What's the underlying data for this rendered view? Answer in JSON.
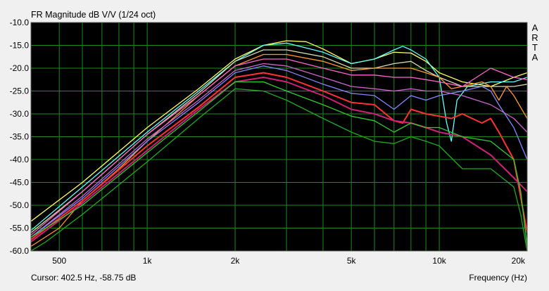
{
  "chart_data": {
    "type": "line",
    "title": "FR Magnitude dB V/V (1/24 oct)",
    "brand_letters": [
      "A",
      "R",
      "T",
      "A"
    ],
    "cursor_readout": "Cursor: 402.5 Hz, -58.75 dB",
    "xlabel": "Frequency (Hz)",
    "ylabel": "",
    "x_scale": "log",
    "xlim": [
      400,
      20000
    ],
    "ylim": [
      -60,
      -10
    ],
    "y_ticks": [
      -10,
      -15,
      -20,
      -25,
      -30,
      -35,
      -40,
      -45,
      -50,
      -55,
      -60
    ],
    "y_tick_labels": [
      "-10.0",
      "-15.0",
      "-20.0",
      "-25.0",
      "-30.0",
      "-35.0",
      "-40.0",
      "-45.0",
      "-50.0",
      "-55.0",
      "-60.0"
    ],
    "x_ticks": [
      500,
      1000,
      2000,
      5000,
      10000,
      20000
    ],
    "x_tick_labels": [
      "500",
      "1k",
      "2k",
      "5k",
      "10k",
      "20k"
    ],
    "x_minor_grid": [
      600,
      700,
      800,
      900,
      3000,
      4000,
      6000,
      7000,
      8000,
      9000
    ],
    "grid": true,
    "background": "#000000",
    "grid_color": "#1f8a1f",
    "series": [
      {
        "color": "#ffff66",
        "points": [
          [
            400,
            -53.5
          ],
          [
            600,
            -45
          ],
          [
            1000,
            -33
          ],
          [
            1500,
            -24.5
          ],
          [
            2000,
            -18
          ],
          [
            2500,
            -15
          ],
          [
            3000,
            -14
          ],
          [
            3500,
            -14.2
          ],
          [
            4000,
            -15.8
          ],
          [
            5000,
            -19
          ],
          [
            6000,
            -18
          ],
          [
            7000,
            -16.5
          ],
          [
            8000,
            -16.7
          ],
          [
            9000,
            -18.5
          ],
          [
            10000,
            -21
          ],
          [
            12000,
            -23
          ],
          [
            15000,
            -24
          ],
          [
            18000,
            -22
          ],
          [
            20000,
            -21
          ]
        ]
      },
      {
        "color": "#66ffff",
        "points": [
          [
            400,
            -55.5
          ],
          [
            600,
            -46
          ],
          [
            1000,
            -34
          ],
          [
            1500,
            -25
          ],
          [
            2000,
            -18.5
          ],
          [
            2500,
            -15
          ],
          [
            3000,
            -14.5
          ],
          [
            4000,
            -16.5
          ],
          [
            5000,
            -19
          ],
          [
            6000,
            -18
          ],
          [
            7000,
            -16
          ],
          [
            7500,
            -15.2
          ],
          [
            8000,
            -16
          ],
          [
            9000,
            -18
          ],
          [
            10000,
            -22
          ],
          [
            10600,
            -32
          ],
          [
            11000,
            -36
          ],
          [
            11500,
            -27
          ],
          [
            12500,
            -24
          ],
          [
            15000,
            -23
          ],
          [
            18000,
            -23
          ],
          [
            20000,
            -22
          ]
        ]
      },
      {
        "color": "#d9d9b0",
        "points": [
          [
            400,
            -56
          ],
          [
            600,
            -47
          ],
          [
            1000,
            -34.5
          ],
          [
            1500,
            -25.5
          ],
          [
            2000,
            -18.5
          ],
          [
            2500,
            -16
          ],
          [
            3000,
            -16
          ],
          [
            4000,
            -17.5
          ],
          [
            5000,
            -20
          ],
          [
            6000,
            -20
          ],
          [
            7000,
            -19
          ],
          [
            8000,
            -18.5
          ],
          [
            9000,
            -20.5
          ],
          [
            10000,
            -22
          ],
          [
            12000,
            -24
          ],
          [
            15000,
            -24
          ],
          [
            18000,
            -24
          ],
          [
            20000,
            -23.5
          ]
        ]
      },
      {
        "color": "#ff9933",
        "points": [
          [
            400,
            -59
          ],
          [
            500,
            -55
          ],
          [
            600,
            -49
          ],
          [
            800,
            -42
          ],
          [
            1000,
            -36
          ],
          [
            1500,
            -26
          ],
          [
            2000,
            -19.5
          ],
          [
            2500,
            -17
          ],
          [
            3000,
            -17
          ],
          [
            4000,
            -18.5
          ],
          [
            5000,
            -20.5
          ],
          [
            6000,
            -20
          ],
          [
            7000,
            -20
          ],
          [
            8000,
            -20
          ],
          [
            9000,
            -21
          ],
          [
            10000,
            -22
          ],
          [
            11000,
            -24.5
          ],
          [
            12000,
            -24
          ],
          [
            14000,
            -23
          ],
          [
            15000,
            -24
          ],
          [
            16000,
            -27
          ],
          [
            17000,
            -24
          ],
          [
            18000,
            -26
          ],
          [
            20000,
            -31
          ]
        ]
      },
      {
        "color": "#ff66cc",
        "points": [
          [
            400,
            -56.5
          ],
          [
            600,
            -47
          ],
          [
            1000,
            -34.5
          ],
          [
            1500,
            -26
          ],
          [
            2000,
            -19.5
          ],
          [
            2500,
            -18
          ],
          [
            3000,
            -18
          ],
          [
            4000,
            -20
          ],
          [
            5000,
            -21.5
          ],
          [
            6000,
            -21.5
          ],
          [
            7000,
            -22
          ],
          [
            8000,
            -22
          ],
          [
            9000,
            -22.5
          ],
          [
            10000,
            -23
          ],
          [
            12000,
            -24
          ],
          [
            15000,
            -20
          ],
          [
            18000,
            -22
          ],
          [
            20000,
            -22.5
          ]
        ]
      },
      {
        "color": "#cc66cc",
        "points": [
          [
            400,
            -57
          ],
          [
            600,
            -48
          ],
          [
            1000,
            -35.5
          ],
          [
            1500,
            -27
          ],
          [
            2000,
            -20.5
          ],
          [
            2500,
            -19
          ],
          [
            3000,
            -19.5
          ],
          [
            4000,
            -22
          ],
          [
            5000,
            -24
          ],
          [
            6000,
            -24.5
          ],
          [
            7000,
            -25
          ],
          [
            8000,
            -24.5
          ],
          [
            9000,
            -25
          ],
          [
            10000,
            -25
          ],
          [
            12000,
            -26
          ],
          [
            15000,
            -28
          ],
          [
            18000,
            -31
          ],
          [
            20000,
            -34
          ]
        ]
      },
      {
        "color": "#8888ff",
        "points": [
          [
            400,
            -57
          ],
          [
            600,
            -48.5
          ],
          [
            1000,
            -36
          ],
          [
            1500,
            -27.5
          ],
          [
            2000,
            -21
          ],
          [
            2500,
            -19.5
          ],
          [
            3000,
            -20.5
          ],
          [
            4000,
            -23.5
          ],
          [
            5000,
            -25.5
          ],
          [
            6000,
            -26
          ],
          [
            7000,
            -29
          ],
          [
            8000,
            -26
          ],
          [
            9000,
            -27
          ],
          [
            10000,
            -26
          ],
          [
            12000,
            -25
          ],
          [
            14000,
            -24
          ],
          [
            15000,
            -25
          ],
          [
            16000,
            -28
          ],
          [
            18000,
            -33
          ],
          [
            20000,
            -40
          ]
        ]
      },
      {
        "color": "#ff3333",
        "points": [
          [
            400,
            -57.5
          ],
          [
            600,
            -49
          ],
          [
            1000,
            -37
          ],
          [
            1500,
            -28.5
          ],
          [
            2000,
            -22
          ],
          [
            2500,
            -21
          ],
          [
            3000,
            -22
          ],
          [
            4000,
            -25
          ],
          [
            5000,
            -27.5
          ],
          [
            6000,
            -28
          ],
          [
            7000,
            -31.5
          ],
          [
            7500,
            -32
          ],
          [
            8000,
            -29
          ],
          [
            9000,
            -30
          ],
          [
            10000,
            -30.5
          ],
          [
            11000,
            -31
          ],
          [
            12000,
            -30
          ],
          [
            14000,
            -32
          ],
          [
            15000,
            -31
          ],
          [
            16000,
            -34
          ],
          [
            18000,
            -40
          ],
          [
            20000,
            -56
          ]
        ]
      },
      {
        "color": "#cc2277",
        "points": [
          [
            400,
            -58
          ],
          [
            600,
            -49.5
          ],
          [
            1000,
            -38
          ],
          [
            1500,
            -29
          ],
          [
            2000,
            -23
          ],
          [
            2500,
            -22
          ],
          [
            3000,
            -23
          ],
          [
            4000,
            -26
          ],
          [
            5000,
            -29
          ],
          [
            6000,
            -30
          ],
          [
            7000,
            -31.5
          ],
          [
            8000,
            -32
          ],
          [
            9000,
            -33
          ],
          [
            10000,
            -34
          ],
          [
            12000,
            -35
          ],
          [
            15000,
            -39
          ],
          [
            18000,
            -44
          ],
          [
            20000,
            -47
          ]
        ]
      },
      {
        "color": "#33cc33",
        "points": [
          [
            400,
            -57
          ],
          [
            600,
            -50
          ],
          [
            1000,
            -38.5
          ],
          [
            1500,
            -29.5
          ],
          [
            2000,
            -23
          ],
          [
            2500,
            -23
          ],
          [
            3000,
            -25
          ],
          [
            4000,
            -28
          ],
          [
            5000,
            -30.5
          ],
          [
            6000,
            -31.5
          ],
          [
            7000,
            -34
          ],
          [
            8000,
            -32
          ],
          [
            9000,
            -33
          ],
          [
            10000,
            -33
          ],
          [
            12000,
            -35
          ],
          [
            15000,
            -36
          ],
          [
            18000,
            -40
          ],
          [
            19000,
            -47
          ],
          [
            20000,
            -59
          ]
        ]
      },
      {
        "color": "#22aa22",
        "points": [
          [
            400,
            -60
          ],
          [
            450,
            -58
          ],
          [
            600,
            -52
          ],
          [
            1000,
            -40.5
          ],
          [
            1500,
            -31
          ],
          [
            2000,
            -24.5
          ],
          [
            2500,
            -25
          ],
          [
            3000,
            -27
          ],
          [
            4000,
            -31
          ],
          [
            5000,
            -34
          ],
          [
            6000,
            -36
          ],
          [
            7000,
            -36.5
          ],
          [
            8000,
            -35
          ],
          [
            9000,
            -36
          ],
          [
            10000,
            -37
          ],
          [
            12000,
            -42
          ],
          [
            15000,
            -42
          ],
          [
            18000,
            -46
          ],
          [
            19000,
            -52
          ],
          [
            20000,
            -60
          ]
        ]
      }
    ]
  }
}
